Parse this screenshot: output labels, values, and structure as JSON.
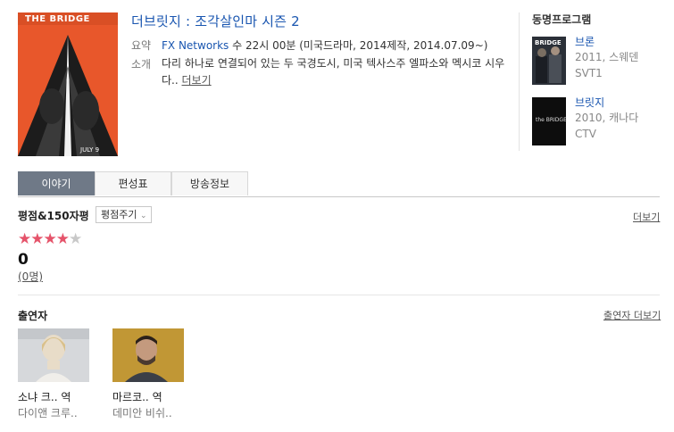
{
  "program": {
    "title": "더브릿지 : 조각살인마 시즌 2",
    "summary_label": "요약",
    "network": "FX Networks",
    "summary_text": "수 22시 00분 (미국드라마, 2014제작, 2014.07.09~)",
    "desc_label": "소개",
    "desc_text": "다리 하나로 연결되어 있는 두 국경도시, 미국 텍사스주 엘파소와 멕시코 시우다..",
    "more_label": "더보기",
    "poster_text": "THE BRIDGE",
    "poster_date": "JULY 9"
  },
  "related": {
    "title": "동명프로그램",
    "items": [
      {
        "name": "브론",
        "info": "2011, 스웨덴",
        "channel": "SVT1",
        "thumb_text": "BRIDGE"
      },
      {
        "name": "브릿지",
        "info": "2010, 캐나다",
        "channel": "CTV",
        "thumb_text": "the BRIDGE"
      }
    ]
  },
  "tabs": [
    "이야기",
    "편성표",
    "방송정보"
  ],
  "rating": {
    "title": "평점&150자평",
    "button": "평점주기",
    "more": "더보기",
    "stars_on": "★★★★",
    "stars_off": "★",
    "score": "0",
    "count": "(0명)",
    "value": 4,
    "max": 5
  },
  "cast": {
    "title": "출연자",
    "more": "출연자 더보기",
    "items": [
      {
        "role": "소냐 크.. 역",
        "name": "다이앤 크루.."
      },
      {
        "role": "마르코.. 역",
        "name": "데미안 비쉬.."
      }
    ]
  },
  "colors": {
    "accent": "#1a56b0",
    "star": "#e5536a",
    "tab_active": "#6f7987"
  }
}
